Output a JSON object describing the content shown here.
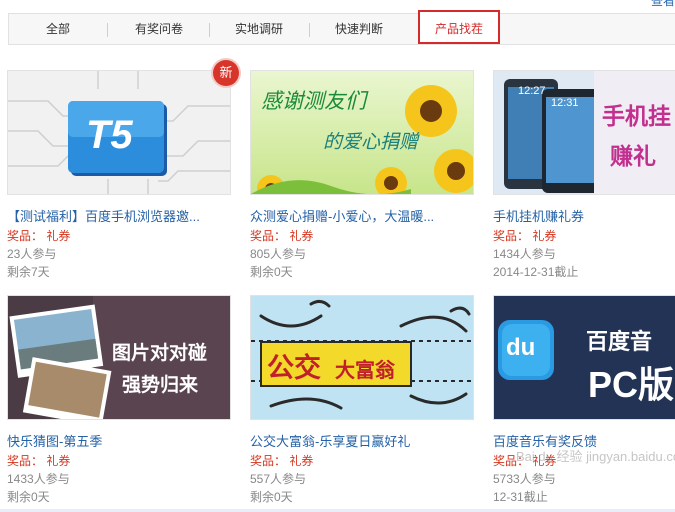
{
  "top_link": "查看",
  "tabs": [
    "全部",
    "有奖问卷",
    "实地调研",
    "快速判断",
    "产品找茬"
  ],
  "active_tab": 4,
  "new_badge": "新",
  "cards": [
    {
      "title": "【测试福利】百度手机浏览器邀...",
      "prize": "奖品： 礼券",
      "participants": "23人参与",
      "remaining": "剩余7天",
      "image_text": "T5"
    },
    {
      "title": "众测爱心捐赠-小爱心，大温暖...",
      "prize": "奖品： 礼券",
      "participants": "805人参与",
      "remaining": "剩余0天",
      "image_text_1": "感谢测友们",
      "image_text_2": "的爱心捐赠"
    },
    {
      "title": "手机挂机赚礼券",
      "prize": "奖品： 礼券",
      "participants": "1434人参与",
      "remaining": "2014-12-31截止",
      "image_text_1": "手机挂",
      "image_text_2": "赚礼",
      "phone_time_1": "12:27",
      "phone_time_2": "12:31"
    },
    {
      "title": "快乐猜图-第五季",
      "prize": "奖品： 礼券",
      "participants": "1433人参与",
      "remaining": "剩余0天",
      "image_text_1": "图片对对碰",
      "image_text_2": "强势归来"
    },
    {
      "title": "公交大富翁-乐享夏日赢好礼",
      "prize": "奖品： 礼券",
      "participants": "557人参与",
      "remaining": "剩余0天",
      "image_text_1": "公交",
      "image_text_2": "大富翁"
    },
    {
      "title": "百度音乐有奖反馈",
      "prize": "奖品： 礼券",
      "participants": "5733人参与",
      "remaining": "12-31截止",
      "image_text_1": "百度音",
      "image_text_2": "PC版",
      "logo_text": "du"
    }
  ],
  "watermark": "Bai du 经验 jingyan.baidu.com",
  "colors": {
    "accent": "#d42a2a",
    "link": "#2461a6",
    "prize": "#d4361f",
    "meta": "#888888"
  }
}
